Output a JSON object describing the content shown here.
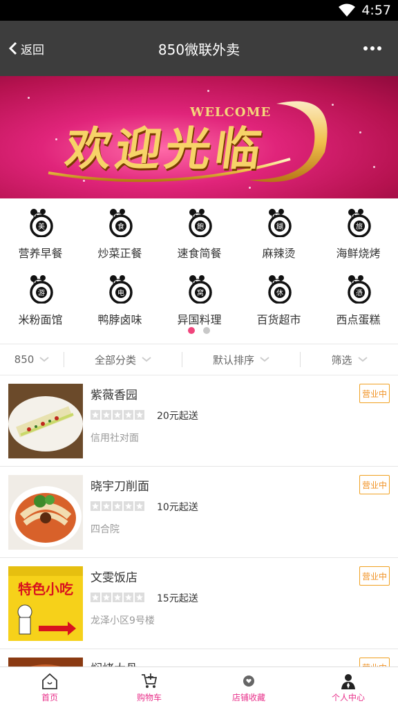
{
  "status_bar": {
    "time": "4:57",
    "wifi_icon": "wifi-icon"
  },
  "navbar": {
    "back_label": "返回",
    "title": "850微联外卖",
    "more_icon": "more-icon"
  },
  "banner": {
    "welcome_en": "WELCOME",
    "welcome_cn": "欢迎光临"
  },
  "categories": [
    {
      "label": "营养早餐",
      "badge": "美"
    },
    {
      "label": "炒菜正餐",
      "badge": "食"
    },
    {
      "label": "速食简餐",
      "badge": "飽"
    },
    {
      "label": "麻辣烫",
      "badge": "餬"
    },
    {
      "label": "海鲜烧烤",
      "badge": "旅"
    },
    {
      "label": "米粉面馆",
      "badge": "游"
    },
    {
      "label": "鸭脖卤味",
      "badge": "电"
    },
    {
      "label": "异国料理",
      "badge": "窝"
    },
    {
      "label": "百货超市",
      "badge": "休"
    },
    {
      "label": "西点蛋糕",
      "badge": "憑"
    }
  ],
  "filters": [
    {
      "label": "850"
    },
    {
      "label": "全部分类"
    },
    {
      "label": "默认排序"
    },
    {
      "label": "筛选"
    }
  ],
  "stores": [
    {
      "name": "紫薇香园",
      "min_order": "20元起送",
      "address": "信用社对面",
      "status": "营业中"
    },
    {
      "name": "晓宇刀削面",
      "min_order": "10元起送",
      "address": "四合院",
      "status": "营业中"
    },
    {
      "name": "文雯饭店",
      "min_order": "15元起送",
      "address": "龙泽小区9号楼",
      "status": "营业中",
      "thumb_text": "特色小吃"
    },
    {
      "name": "焖烤大骨",
      "min_order": "",
      "address": "",
      "status": "营业中"
    }
  ],
  "tabs": [
    {
      "label": "首页",
      "icon": "home-icon"
    },
    {
      "label": "购物车",
      "icon": "cart-icon"
    },
    {
      "label": "店铺收藏",
      "icon": "favorite-store-icon"
    },
    {
      "label": "个人中心",
      "icon": "user-icon"
    }
  ],
  "colors": {
    "accent": "#e8308a",
    "nav": "#3d3d3d",
    "status_badge": "#f09020",
    "dot_active": "#f0457c"
  }
}
